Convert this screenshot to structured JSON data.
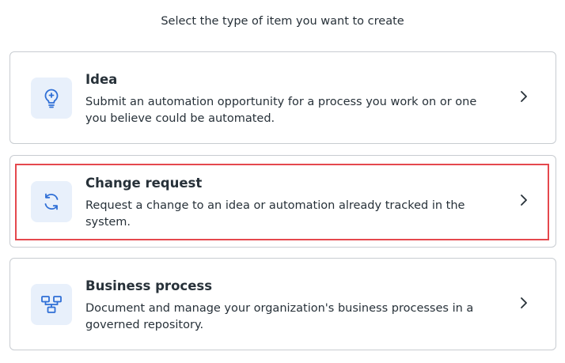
{
  "prompt": "Select the type of item you want to create",
  "items": [
    {
      "title": "Idea",
      "description": "Submit an automation opportunity for a process you work on or one you believe could be automated.",
      "icon": "lightbulb-icon"
    },
    {
      "title": "Change request",
      "description": "Request a change to an idea or automation already tracked in the system.",
      "icon": "sync-arrows-icon"
    },
    {
      "title": "Business process",
      "description": "Document and manage your organization's business processes in a governed repository.",
      "icon": "process-diagram-icon"
    }
  ],
  "colors": {
    "accent": "#2f6fd6",
    "icon_bg": "#e8f0fb",
    "highlight": "#e5484d",
    "border": "#c8ccd1",
    "text": "#273139"
  }
}
